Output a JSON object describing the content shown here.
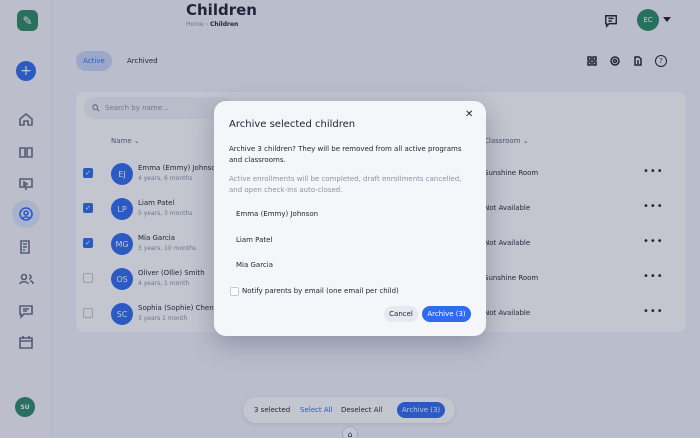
{
  "header": {
    "title": "Children",
    "breadcrumb_home": "Home",
    "breadcrumb_current": "Children",
    "avatar_initials": "EC"
  },
  "sidebar": {
    "user_initials": "SU",
    "items": [
      "home",
      "book",
      "presentation",
      "children",
      "forms",
      "people",
      "messages",
      "calendar"
    ]
  },
  "tabs": {
    "active": "Active",
    "archived": "Archived"
  },
  "search": {
    "placeholder": "Search by name..."
  },
  "table": {
    "col_name": "Name",
    "col_class": "Classroom",
    "rows": [
      {
        "initials": "EJ",
        "name": "Emma (Emmy) Johnson",
        "age": "4 years, 6 months",
        "classroom": "Sunshine Room",
        "checked": true
      },
      {
        "initials": "LP",
        "name": "Liam Patel",
        "age": "5 years, 3 months",
        "classroom": "Not Available",
        "checked": true
      },
      {
        "initials": "MG",
        "name": "Mia Garcia",
        "age": "3 years, 10 months",
        "classroom": "Not Available",
        "checked": true
      },
      {
        "initials": "OS",
        "name": "Oliver (Ollie) Smith",
        "age": "4 years, 1 month",
        "classroom": "Sunshine Room",
        "checked": false
      },
      {
        "initials": "SC",
        "name": "Sophia (Sophie) Chen",
        "age": "3 years 1 month",
        "classroom": "Not Available",
        "checked": false
      }
    ]
  },
  "bottombar": {
    "selected": "3 selected",
    "select_all": "Select All",
    "deselect_all": "Deselect All",
    "archive": "Archive (3)"
  },
  "modal": {
    "title": "Archive selected children",
    "close": "✕",
    "body": "Archive 3 children? They will be removed from all active programs and classrooms.",
    "note": "Active enrollments will be completed, draft enrollments cancelled, and open check-ins auto-closed.",
    "items": [
      "Emma (Emmy) Johnson",
      "Liam Patel",
      "Mia Garcia"
    ],
    "notify_label": "Notify parents by email (one email per child)",
    "notify_checked": false,
    "cancel": "Cancel",
    "archive": "Archive (3)"
  },
  "colors": {
    "accent": "#2f6bf0",
    "brand": "#2a8a64"
  }
}
